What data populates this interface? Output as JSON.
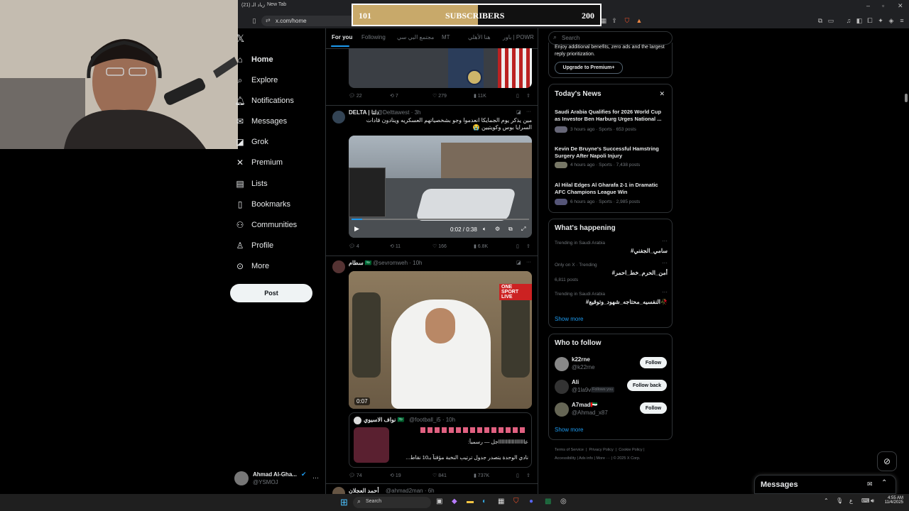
{
  "browser": {
    "tabs": [
      "(21) زياد الـ",
      "New Tab"
    ],
    "url": "x.com/home"
  },
  "overlay": {
    "left_value": "101",
    "label": "SUBSCRIBERS",
    "right_value": "200",
    "progress": 0.505
  },
  "nav": {
    "items": [
      "Home",
      "Explore",
      "Notifications",
      "Messages",
      "Grok",
      "Premium",
      "Lists",
      "Bookmarks",
      "Communities",
      "Profile",
      "More"
    ],
    "notifications_badge": "",
    "post_label": "Post",
    "account_name": "Ahmad Al-Gha...",
    "account_handle": "@YSMOJ"
  },
  "feed": {
    "tabs": [
      "For you",
      "Following",
      "مجتمع البي سي",
      "MT",
      "هنا الأهلي",
      "باور | POWR"
    ],
    "tweet1": {
      "replies": "22",
      "reposts": "7",
      "likes": "279",
      "views": "11K"
    },
    "tweet2": {
      "name": "DELTA | دلتا",
      "handle": "@Delttawest · 3h",
      "text": "مين يذكر يوم الجمايكا انعدموا وجو بشخصياتهم العسكريه وينادون قادات السرايا بوس وكويتيين 😭",
      "video_time": "0:02 / 0:38",
      "replies": "4",
      "reposts": "11",
      "likes": "166",
      "views": "6.8K"
    },
    "tweet3": {
      "name": "سطام 🇸🇦",
      "handle": "@sevromweh · 10h",
      "video_time": "0:07",
      "video_label": "ONE SPORT LIVE",
      "quote_name": "نواف الاسيوي 🇸🇦",
      "quote_handle": "@football_i5 · 10h",
      "quote_line1": "عااااااااااااااااااجل — رسمياً:",
      "quote_line2": "نادي الوحدة يتصدر جدول ترتيب النخبة مؤقتاً بـ10 نقاط...",
      "replies": "74",
      "reposts": "19",
      "likes": "841",
      "views": "737K"
    },
    "tweet4": {
      "name": "أحمد العجلان",
      "handle": "@ahmad2man · 6h"
    }
  },
  "sidebar": {
    "search_placeholder": "Search",
    "premium_text": "Enjoy additional benefits, zero ads and the largest reply prioritization.",
    "premium_button": "Upgrade to Premium+",
    "news_title": "Today's News",
    "news": [
      {
        "title": "Saudi Arabia Qualifies for 2026 World Cup as Investor Ben Harburg Urges National ...",
        "meta": "3 hours ago · Sports · 653 posts"
      },
      {
        "title": "Kevin De Bruyne's Successful Hamstring Surgery After Napoli Injury",
        "meta": "4 hours ago · Sports · 7,438 posts"
      },
      {
        "title": "Al Hilal Edges Al Gharafa 2-1 in Dramatic AFC Champions League Win",
        "meta": "6 hours ago · Sports · 2,985 posts"
      }
    ],
    "happening_title": "What's happening",
    "trends": [
      {
        "context": "Trending in Saudi Arabia",
        "name": "#سامي_الجفني",
        "posts": ""
      },
      {
        "context": "Only on X · Trending",
        "name": "#أمن_الحرم_خط_احمر",
        "posts": "6,811 posts"
      },
      {
        "context": "Trending in Saudi Arabia",
        "name": "#النفسيه_محتاجه_شهود_وتوقيع🥀",
        "posts": ""
      }
    ],
    "show_more": "Show more",
    "who_title": "Who to follow",
    "follow": [
      {
        "name": "k22rne",
        "handle": "@k22rne",
        "button": "Follow",
        "badge": ""
      },
      {
        "name": "Ali",
        "handle": "@1la9v",
        "button": "Follow back",
        "badge": "Follows you"
      },
      {
        "name": "A7mad🇦🇪",
        "handle": "@Ahmad_x87",
        "button": "Follow",
        "badge": ""
      }
    ],
    "footer": [
      "Terms of Service",
      "Privacy Policy",
      "Cookie Policy",
      "Accessibility",
      "Ads info",
      "More ···",
      "© 2025 X Corp."
    ]
  },
  "messages_label": "Messages",
  "taskbar": {
    "search": "Search",
    "time": "4:55 AM",
    "date": "11/4/2025"
  },
  "colors": {
    "accent": "#1d9bf0",
    "progress_fill": "#c8a96a",
    "background": "#000000"
  }
}
